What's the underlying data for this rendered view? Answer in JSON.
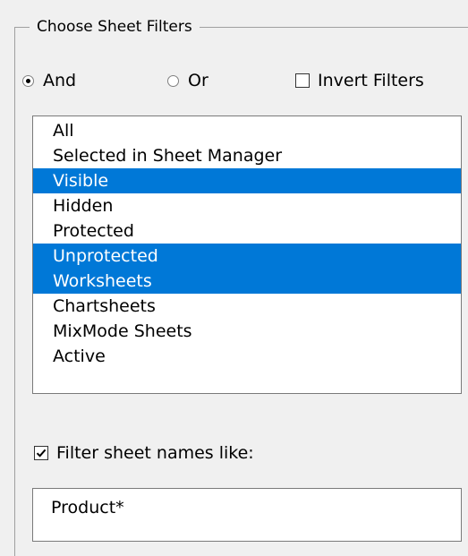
{
  "group": {
    "title": "Choose Sheet Filters"
  },
  "logic": {
    "and_label": "And",
    "or_label": "Or",
    "selected": "And"
  },
  "invert": {
    "label": "Invert Filters",
    "checked": false
  },
  "filters": {
    "items": [
      {
        "label": "All",
        "selected": false
      },
      {
        "label": "Selected in Sheet Manager",
        "selected": false
      },
      {
        "label": "Visible",
        "selected": true
      },
      {
        "label": "Hidden",
        "selected": false
      },
      {
        "label": "Protected",
        "selected": false
      },
      {
        "label": "Unprotected",
        "selected": true
      },
      {
        "label": "Worksheets",
        "selected": true
      },
      {
        "label": "Chartsheets",
        "selected": false
      },
      {
        "label": "MixMode Sheets",
        "selected": false
      },
      {
        "label": "Active",
        "selected": false
      }
    ]
  },
  "name_filter": {
    "label": "Filter sheet names like:",
    "checked": true,
    "value": "Product*"
  },
  "colors": {
    "selection": "#0078d7",
    "panel_background": "#f0f0f0"
  }
}
